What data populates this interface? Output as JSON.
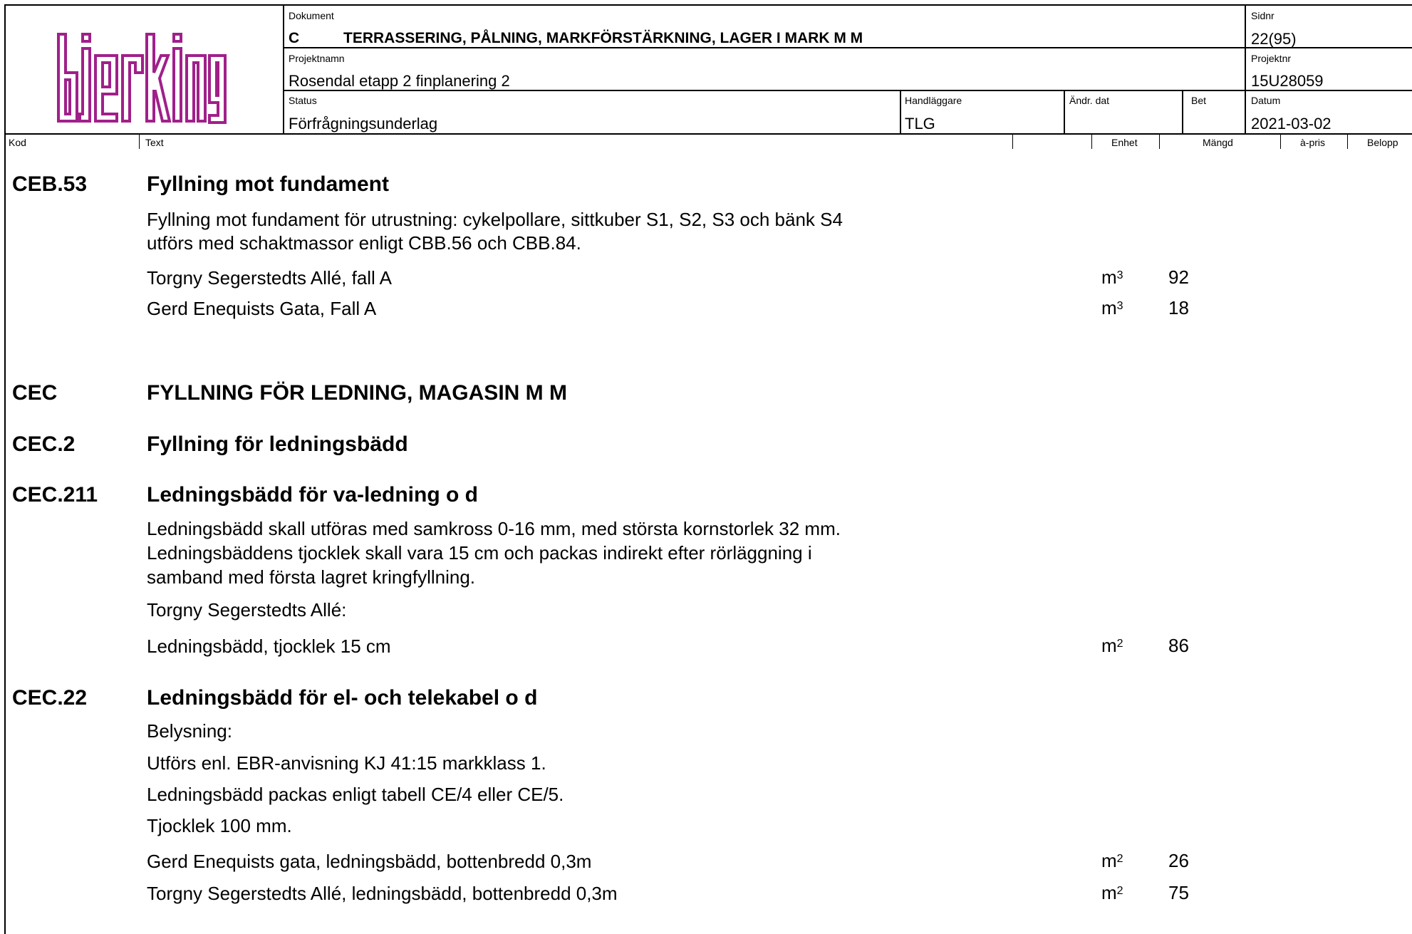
{
  "header": {
    "logo_text": "bjerking",
    "dokument": {
      "label": "Dokument",
      "code": "C",
      "value": "TERRASSERING, PÅLNING, MARKFÖRSTÄRKNING, LAGER I MARK M M"
    },
    "sidnr": {
      "label": "Sidnr",
      "value": "22(95)"
    },
    "projektnamn": {
      "label": "Projektnamn",
      "value": "Rosendal etapp 2 finplanering 2"
    },
    "projektnr": {
      "label": "Projektnr",
      "value": "15U28059"
    },
    "status": {
      "label": "Status",
      "value": "Förfrågningsunderlag"
    },
    "handlaggare": {
      "label": "Handläggare",
      "value": "TLG"
    },
    "andr_dat": {
      "label": "Ändr. dat",
      "value": ""
    },
    "bet": {
      "label": "Bet",
      "value": ""
    },
    "datum": {
      "label": "Datum",
      "value": "2021-03-02"
    }
  },
  "columns": {
    "kod": "Kod",
    "text": "Text",
    "enhet": "Enhet",
    "mangd": "Mängd",
    "apris": "à-pris",
    "belopp": "Belopp"
  },
  "sections": {
    "ceb53": {
      "code": "CEB.53",
      "title": "Fyllning mot fundament",
      "text1": "Fyllning mot fundament för utrustning: cykelpollare, sittkuber S1, S2, S3 och bänk S4",
      "text2": "utförs med schaktmassor enligt CBB.56 och CBB.84.",
      "items": [
        {
          "desc": "Torgny Segerstedts Allé, fall A",
          "unit": "m",
          "exp": "3",
          "qty": "92"
        },
        {
          "desc": "Gerd Enequists Gata, Fall A",
          "unit": "m",
          "exp": "3",
          "qty": "18"
        }
      ]
    },
    "cec": {
      "code": "CEC",
      "title": "FYLLNING FÖR LEDNING, MAGASIN M M"
    },
    "cec2": {
      "code": "CEC.2",
      "title": "Fyllning för ledningsbädd"
    },
    "cec211": {
      "code": "CEC.211",
      "title": "Ledningsbädd för va-ledning o d",
      "text1": "Ledningsbädd skall utföras med samkross 0-16 mm, med största kornstorlek 32 mm.",
      "text2": "Ledningsbäddens tjocklek skall vara 15 cm och packas indirekt efter rörläggning i",
      "text3": "samband med första lagret kringfyllning.",
      "sub": "Torgny Segerstedts Allé:",
      "items": [
        {
          "desc": "Ledningsbädd, tjocklek 15 cm",
          "unit": "m",
          "exp": "2",
          "qty": "86"
        }
      ]
    },
    "cec22": {
      "code": "CEC.22",
      "title": "Ledningsbädd för el- och telekabel o d",
      "text1": "Belysning:",
      "text2": "Utförs enl. EBR-anvisning KJ 41:15 markklass 1.",
      "text3": "Ledningsbädd packas enligt tabell CE/4 eller CE/5.",
      "text4": "Tjocklek 100 mm.",
      "items": [
        {
          "desc": "Gerd Enequists gata, ledningsbädd, bottenbredd 0,3m",
          "unit": "m",
          "exp": "2",
          "qty": "26"
        },
        {
          "desc": "Torgny Segerstedts Allé, ledningsbädd, bottenbredd 0,3m",
          "unit": "m",
          "exp": "2",
          "qty": "75"
        }
      ]
    }
  },
  "colors": {
    "logo": "#a0208a",
    "text": "#000000",
    "background": "#ffffff"
  }
}
